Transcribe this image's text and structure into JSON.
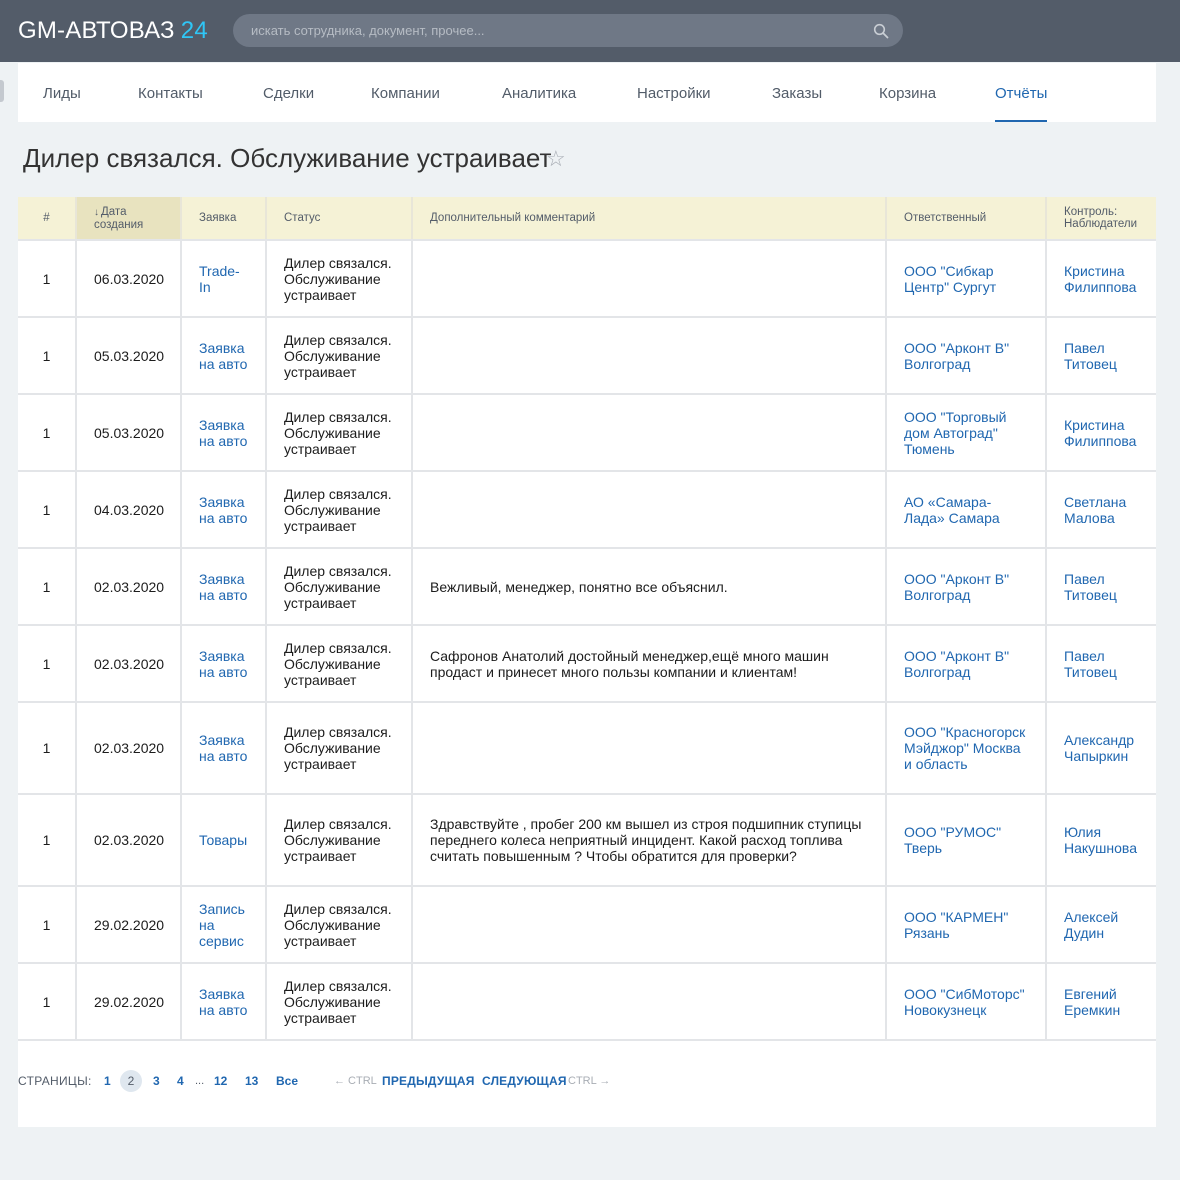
{
  "app": {
    "title": "GM-АВТОВАЗ",
    "title_num": "24"
  },
  "search": {
    "placeholder": "искать сотрудника, документ, прочее..."
  },
  "nav": [
    {
      "label": "Лиды"
    },
    {
      "label": "Контакты"
    },
    {
      "label": "Сделки"
    },
    {
      "label": "Компании"
    },
    {
      "label": "Аналитика"
    },
    {
      "label": "Настройки"
    },
    {
      "label": "Заказы"
    },
    {
      "label": "Корзина"
    },
    {
      "label": "Отчёты"
    }
  ],
  "nav_active": "Отчёты",
  "page_title": "Дилер связался. Обслуживание устраивает",
  "table": {
    "headers": {
      "num": "#",
      "date_line1": "Дата",
      "date_line2": "создания",
      "request": "Заявка",
      "status": "Статус",
      "comment": "Дополнительный комментарий",
      "responsible": "Ответственный",
      "control_line1": "Контроль:",
      "control_line2": "Наблюдатели"
    },
    "rows": [
      {
        "num": "1",
        "date": "06.03.2020",
        "request": "Trade-In",
        "status": "Дилер связался. Обслуживание устраивает",
        "comment": "",
        "responsible": "ООО \"Сибкар Центр\" Сургут",
        "control": "Кристина Филиппова"
      },
      {
        "num": "1",
        "date": "05.03.2020",
        "request": "Заявка на авто",
        "status": "Дилер связался. Обслуживание устраивает",
        "comment": "",
        "responsible": "ООО \"Арконт В\" Волгоград",
        "control": "Павел Титовец"
      },
      {
        "num": "1",
        "date": "05.03.2020",
        "request": "Заявка на авто",
        "status": "Дилер связался. Обслуживание устраивает",
        "comment": "",
        "responsible": "ООО \"Торговый дом Автоград\" Тюмень",
        "control": "Кристина Филиппова"
      },
      {
        "num": "1",
        "date": "04.03.2020",
        "request": "Заявка на авто",
        "status": "Дилер связался. Обслуживание устраивает",
        "comment": "",
        "responsible": "АО «Самара-Лада» Самара",
        "control": "Светлана Малова"
      },
      {
        "num": "1",
        "date": "02.03.2020",
        "request": "Заявка на авто",
        "status": "Дилер связался. Обслуживание устраивает",
        "comment": "Вежливый, менеджер, понятно все объяснил.",
        "responsible": "ООО \"Арконт В\" Волгоград",
        "control": "Павел Титовец"
      },
      {
        "num": "1",
        "date": "02.03.2020",
        "request": "Заявка на авто",
        "status": "Дилер связался. Обслуживание устраивает",
        "comment": "Сафронов Анатолий достойный менеджер,ещё много машин продаст и принесет много пользы компании и клиентам!",
        "responsible": "ООО \"Арконт В\" Волгоград",
        "control": "Павел Титовец"
      },
      {
        "num": "1",
        "date": "02.03.2020",
        "request": "Заявка на авто",
        "status": "Дилер связался. Обслуживание устраивает",
        "comment": "",
        "responsible": "ООО \"Красногорск Мэйджор\" Москва и область",
        "control": "Александр Чапыркин"
      },
      {
        "num": "1",
        "date": "02.03.2020",
        "request": "Товары",
        "status": "Дилер связался. Обслуживание устраивает",
        "comment": "Здравствуйте , пробег 200 км вышел из строя подшипник ступицы переднего колеса неприятный инцидент. Какой расход топлива считать повышенным ? Чтобы обратится для проверки?",
        "responsible": "ООО \"РУМОС\" Тверь",
        "control": "Юлия Накушнова"
      },
      {
        "num": "1",
        "date": "29.02.2020",
        "request": "Запись на сервис",
        "status": "Дилер связался. Обслуживание устраивает",
        "comment": "",
        "responsible": "ООО \"КАРМЕН\" Рязань",
        "control": "Алексей Дудин"
      },
      {
        "num": "1",
        "date": "29.02.2020",
        "request": "Заявка на авто",
        "status": "Дилер связался. Обслуживание устраивает",
        "comment": "",
        "responsible": "ООО \"СибМоторс\" Новокузнецк",
        "control": "Евгений Еремкин"
      }
    ]
  },
  "pager": {
    "label": "СТРАНИЦЫ:",
    "pages": [
      "1",
      "2",
      "3",
      "4"
    ],
    "current": "2",
    "ellipsis": "...",
    "pages_tail": [
      "12",
      "13"
    ],
    "all": "Все",
    "ctrl_left": "← CTRL",
    "prev": "ПРЕДЫДУЩАЯ",
    "next": "СЛЕДУЮЩАЯ",
    "ctrl_right": "CTRL →"
  }
}
